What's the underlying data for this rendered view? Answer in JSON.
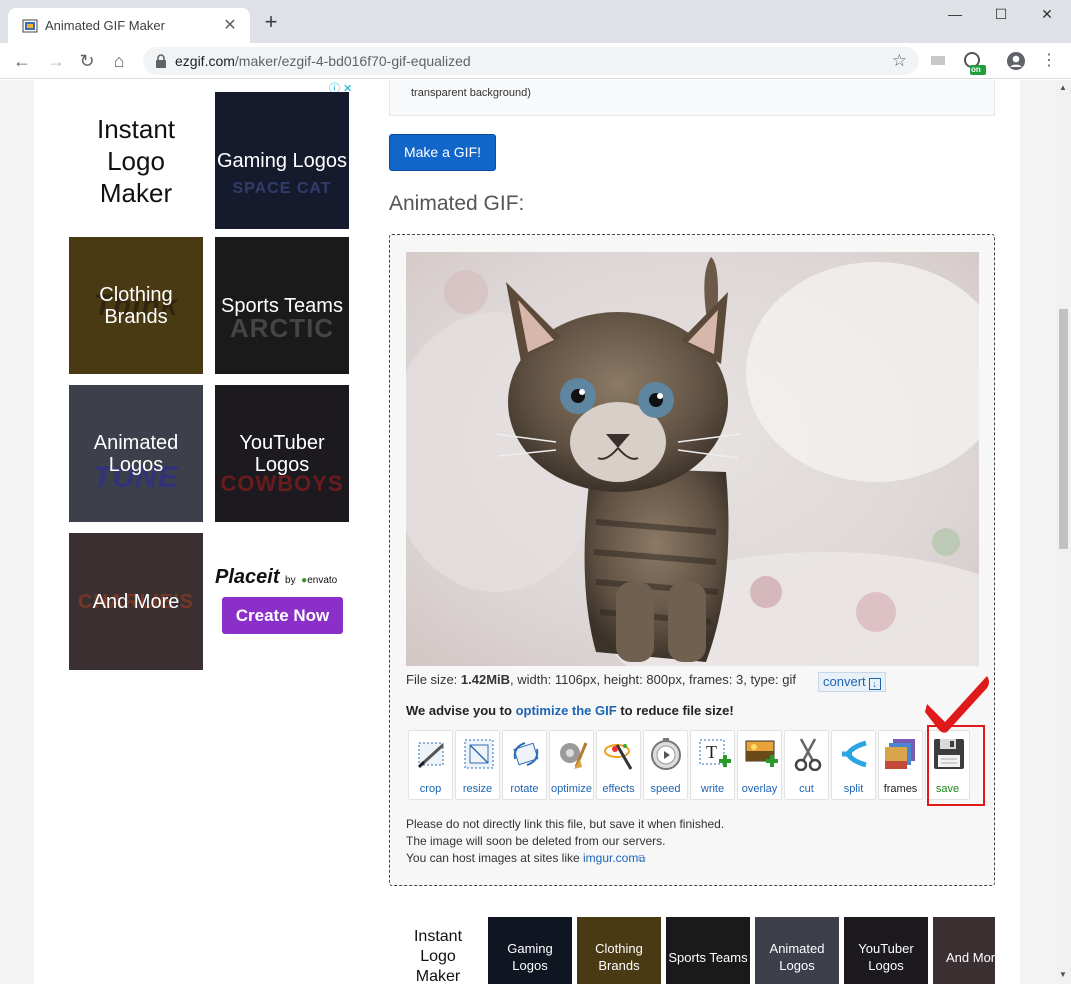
{
  "browser": {
    "tab_title": "Animated GIF Maker",
    "url_host": "ezgif.com",
    "url_path": "/maker/ezgif-4-bd016f70-gif-equalized",
    "new_tab_icon": "+",
    "extension_badge": "on"
  },
  "ad": {
    "tiles": [
      {
        "label": "Instant Logo Maker"
      },
      {
        "label": "Gaming Logos",
        "bg": "SPACE CAT"
      },
      {
        "label": "Clothing Brands",
        "bg": "Think"
      },
      {
        "label": "Sports Teams",
        "bg": "ARCTIC"
      },
      {
        "label": "Animated Logos",
        "bg": "TUNE"
      },
      {
        "label": "YouTuber Logos",
        "bg": "COWBOYS"
      },
      {
        "label": "And More",
        "bg": "CHARLIE'S"
      }
    ],
    "brand": "Placeit",
    "brand_by": "by",
    "brand_partner": "envato",
    "cta": "Create Now"
  },
  "main": {
    "info_text": "transparent background)",
    "make_gif_button": "Make a GIF!",
    "section_title": "Animated GIF:",
    "file_info": {
      "prefix": "File size: ",
      "size": "1.42MiB",
      "rest": ", width: 1106px, height: 800px, frames: 3, type: gif"
    },
    "convert_label": "convert",
    "advise_prefix": "We advise you to ",
    "advise_link": "optimize the GIF",
    "advise_suffix": " to reduce file size!",
    "tools": [
      "crop",
      "resize",
      "rotate",
      "optimize",
      "effects",
      "speed",
      "write",
      "overlay",
      "cut",
      "split",
      "frames",
      "save"
    ],
    "notes": [
      "Please do not directly link this file, but save it when finished.",
      "The image will soon be deleted from our servers."
    ],
    "notes_host_prefix": "You can host images at sites like ",
    "notes_host_link": "imgur.com"
  },
  "strip": {
    "tiles": [
      "Instant Logo Maker",
      "Gaming Logos",
      "Clothing Brands",
      "Sports Teams",
      "Animated Logos",
      "YouTuber Logos",
      "And More"
    ]
  }
}
